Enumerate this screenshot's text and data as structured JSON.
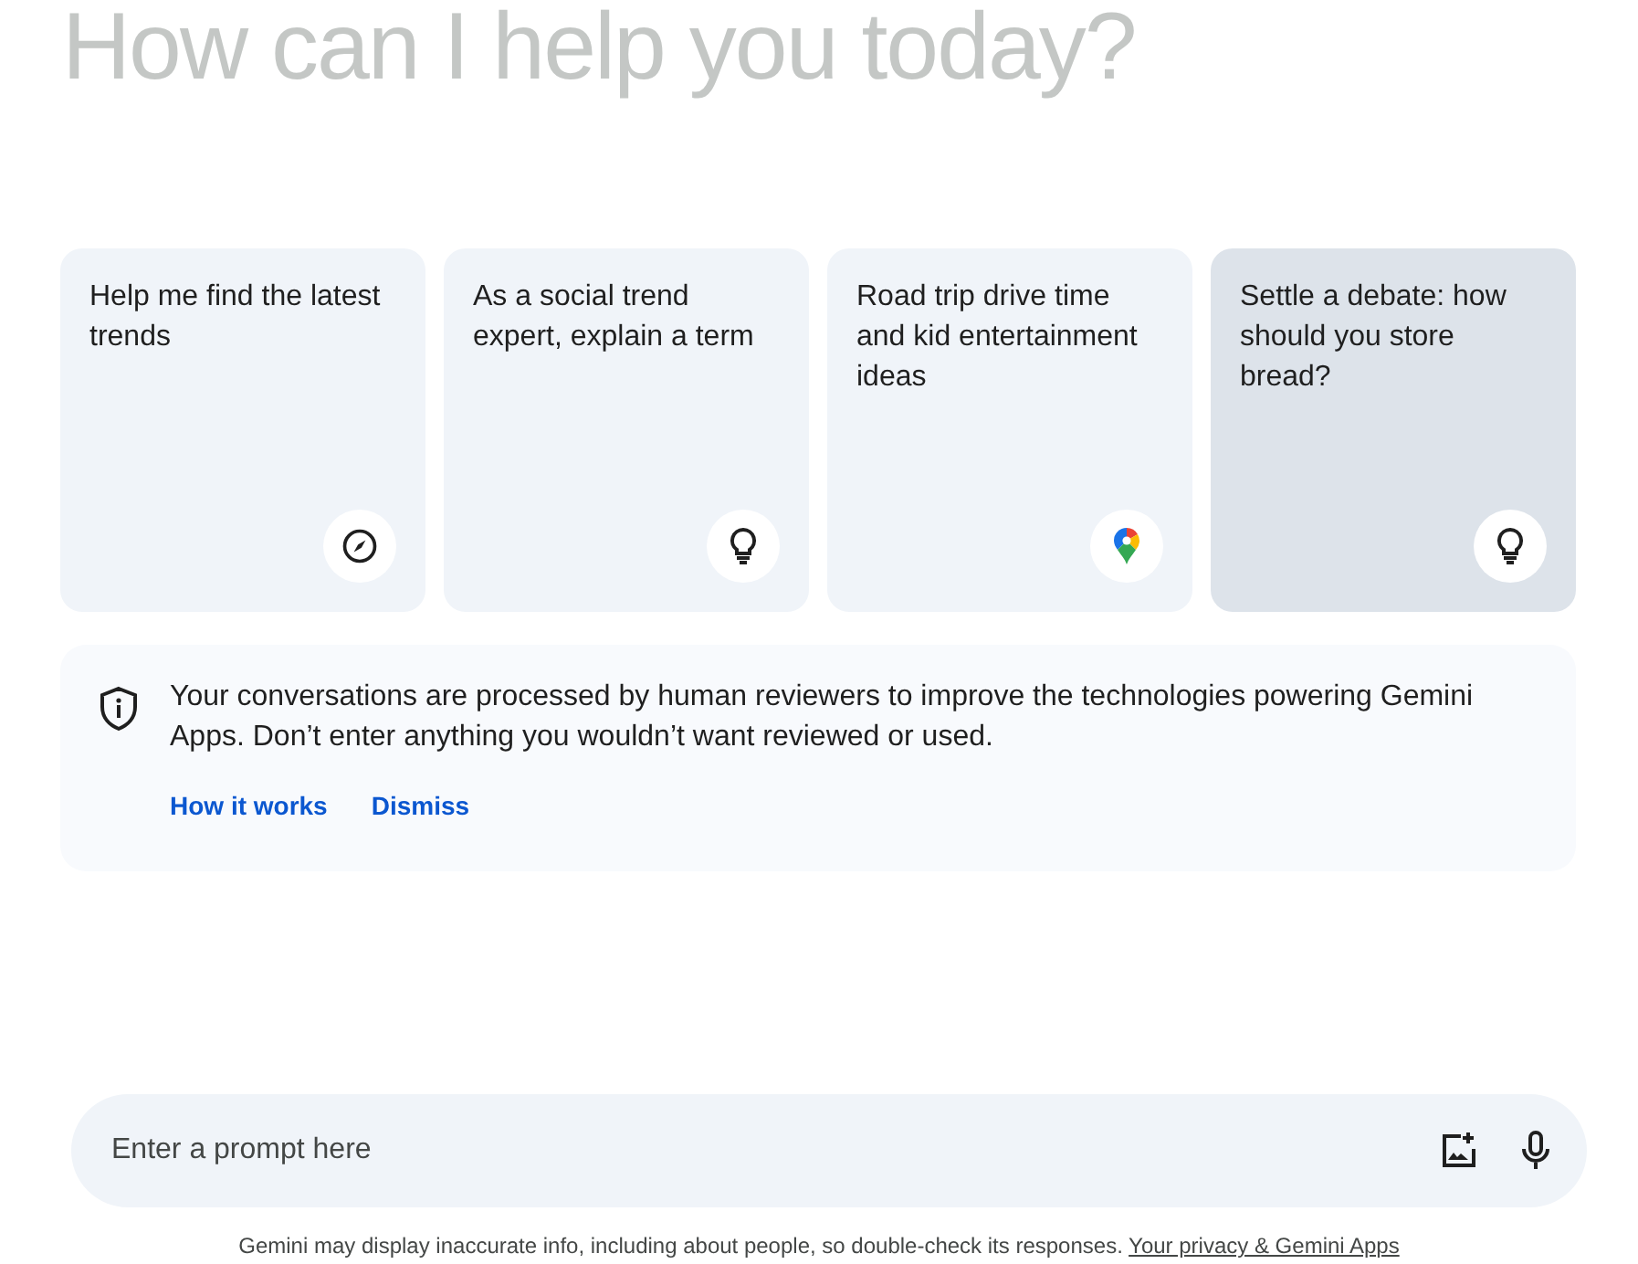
{
  "greeting": "How can I help you today?",
  "cards": [
    {
      "text": "Help me find the latest trends",
      "kind": "explore",
      "highlighted": false
    },
    {
      "text": "As a social trend expert, explain a term",
      "kind": "idea",
      "highlighted": false
    },
    {
      "text": "Road trip drive time and kid entertainment ideas",
      "kind": "place",
      "highlighted": false
    },
    {
      "text": "Settle a debate: how should you store bread?",
      "kind": "idea",
      "highlighted": true
    }
  ],
  "notice": {
    "text": "Your conversations are processed by human reviewers to improve the technologies powering Gemini Apps. Don’t enter anything you wouldn’t want reviewed or used.",
    "links": [
      "How it works",
      "Dismiss"
    ]
  },
  "prompt": {
    "placeholder": "Enter a prompt here"
  },
  "footer": {
    "text": "Gemini may display inaccurate info, including about people, so double-check its responses.",
    "link": "Your privacy & Gemini Apps"
  }
}
